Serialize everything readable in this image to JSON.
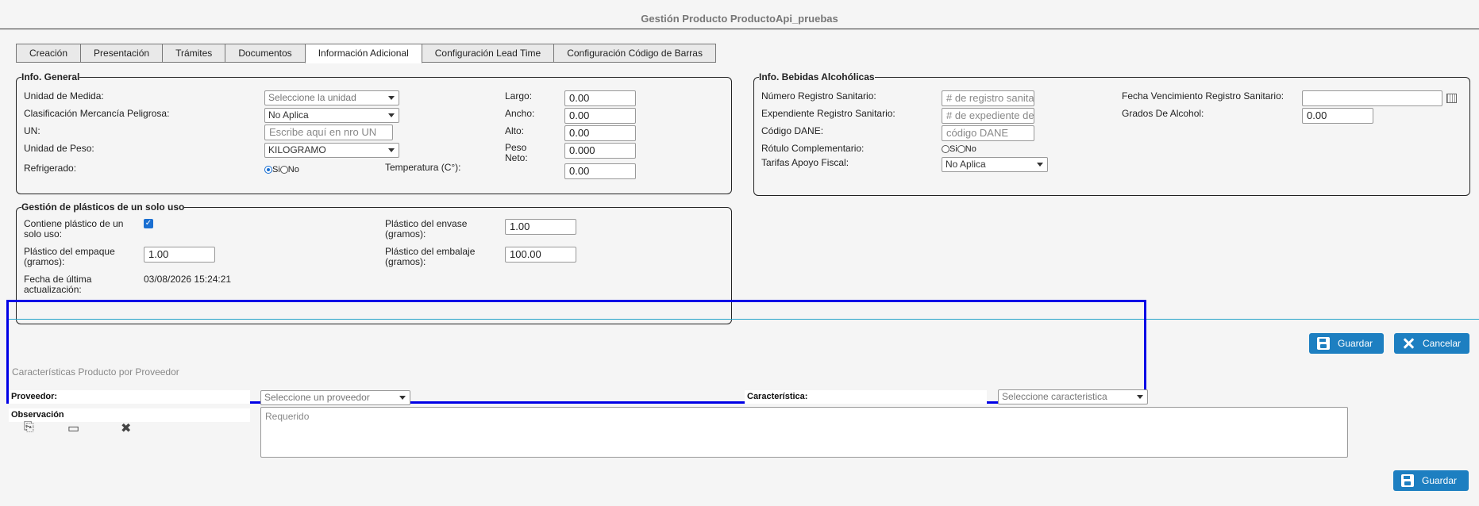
{
  "page_title": "Gestión Producto ProductoApi_pruebas",
  "tabs": [
    {
      "label": "Creación"
    },
    {
      "label": "Presentación"
    },
    {
      "label": "Trámites"
    },
    {
      "label": "Documentos"
    },
    {
      "label": "Información Adicional"
    },
    {
      "label": "Configuración Lead Time"
    },
    {
      "label": "Configuración Código de Barras"
    }
  ],
  "info_general": {
    "legend": "Info. General",
    "unidad_medida": {
      "label": "Unidad de Medida:",
      "placeholder": "Seleccione la unidad"
    },
    "clasificacion": {
      "label": "Clasificación Mercancía Peligrosa:",
      "value": "No Aplica"
    },
    "un": {
      "label": "UN:",
      "placeholder": "Escribe aquí en nro UN"
    },
    "unidad_peso": {
      "label": "Unidad de Peso:",
      "value": "KILOGRAMO"
    },
    "refrigerado": {
      "label": "Refrigerado:",
      "opt_si": "Si",
      "opt_no": "No"
    },
    "largo": {
      "label": "Largo:",
      "value": "0.00"
    },
    "ancho": {
      "label": "Ancho:",
      "value": "0.00"
    },
    "alto": {
      "label": "Alto:",
      "value": "0.00"
    },
    "peso_neto": {
      "label1": "Peso",
      "label2": "Neto:",
      "value": "0.000"
    },
    "temperatura": {
      "label": "Temperatura (C°):",
      "value": "0.00"
    }
  },
  "bebidas": {
    "legend": "Info. Bebidas Alcohólicas",
    "registro_sanitario": {
      "label": "Número Registro Sanitario:",
      "placeholder": "# de registro sanitario"
    },
    "expediente": {
      "label": "Expendiente Registro Sanitario:",
      "placeholder": "# de expediente del registro"
    },
    "codigo_dane": {
      "label": "Código DANE:",
      "placeholder": "código DANE"
    },
    "rotulo": {
      "label": "Rótulo Complementario:",
      "opt_si": "Si",
      "opt_no": "No"
    },
    "tarifas": {
      "label": "Tarifas Apoyo Fiscal:",
      "value": "No Aplica"
    },
    "fecha_vencimiento": {
      "label": "Fecha Vencimiento Registro Sanitario:",
      "value": ""
    },
    "grados_alcohol": {
      "label": "Grados De Alcohol:",
      "value": "0.00"
    }
  },
  "plasticos": {
    "legend": "Gestión de plásticos de un solo uso",
    "contiene": {
      "label1": "Contiene plástico de un",
      "label2": "solo uso:"
    },
    "empaque": {
      "label1": "Plástico del empaque",
      "label2": "(gramos):",
      "value": "1.00"
    },
    "fecha": {
      "label1": "Fecha de última",
      "label2": "actualización:",
      "value": "03/08/2026 15:24:21"
    },
    "envase": {
      "label1": "Plástico del envase",
      "label2": "(gramos):",
      "value": "1.00"
    },
    "embalaje": {
      "label1": "Plástico del embalaje",
      "label2": "(gramos):",
      "value": "100.00"
    }
  },
  "buttons": {
    "guardar": "Guardar",
    "cancelar": "Cancelar",
    "guardar2": "Guardar"
  },
  "proveedor_panel": {
    "title": "Características Producto por Proveedor",
    "proveedor_label": "Proveedor:",
    "proveedor_placeholder": "Seleccione un proveedor",
    "caracteristica_label": "Característica:",
    "caracteristica_placeholder": "Seleccione caracteristica",
    "observacion_label": "Observación",
    "observacion_placeholder": "Requerido"
  },
  "colors": {
    "accent": "#1d7fc1",
    "highlight_border": "#0000e6",
    "panel_rule": "#29a5c9"
  }
}
